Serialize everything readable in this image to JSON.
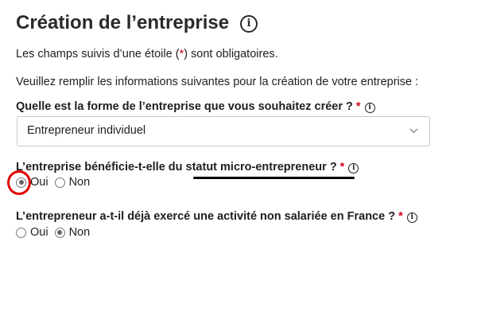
{
  "page": {
    "title": "Création de l’entreprise",
    "info_symbol": "i",
    "required_note": {
      "before": "Les champs suivis d’une étoile (",
      "star": "*",
      "after": ") sont obligatoires."
    },
    "intro": "Veuillez remplir les informations suivantes pour la création de votre entreprise :"
  },
  "questions": [
    {
      "label": "Quelle est la forme de l’entreprise que vous souhaitez créer ?",
      "star": "*",
      "select_value": "Entrepreneur individuel"
    },
    {
      "label": "L’entreprise bénéficie-t-elle du statut micro-entrepreneur ?",
      "star": "*",
      "options": [
        "Oui",
        "Non"
      ],
      "selected": "Oui"
    },
    {
      "label": "L’entrepreneur a-t-il déjà exercé une activité non salariée en France ?",
      "star": "*",
      "options": [
        "Oui",
        "Non"
      ],
      "selected": "Non"
    }
  ],
  "annotations": {
    "underline_color": "#000000",
    "circle_color": "#e00000"
  }
}
